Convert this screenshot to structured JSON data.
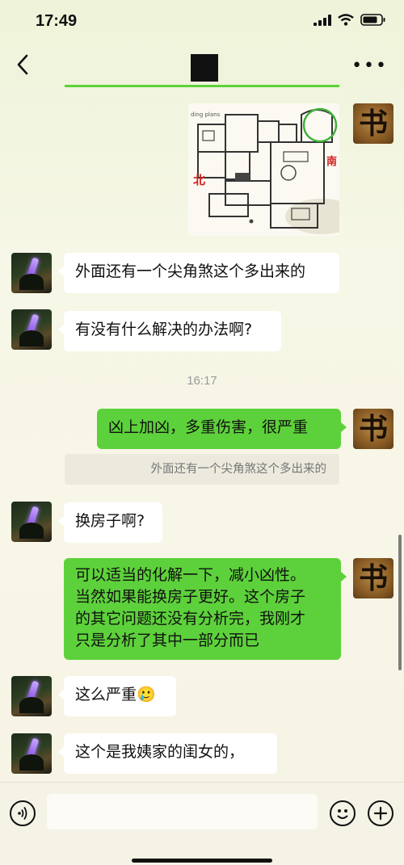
{
  "status_bar": {
    "time": "17:49"
  },
  "header": {
    "title": ""
  },
  "messages": [
    {
      "sender": "me",
      "type": "image",
      "labels": [
        "ding plans",
        "北",
        "南"
      ]
    },
    {
      "sender": "other",
      "text": "外面还有一个尖角煞这个多出来的"
    },
    {
      "sender": "other",
      "text": "有没有什么解决的办法啊?"
    },
    {
      "sender": "system",
      "text": "16:17"
    },
    {
      "sender": "me",
      "text": "凶上加凶，多重伤害，很严重",
      "quote": "外面还有一个尖角煞这个多出来的"
    },
    {
      "sender": "other",
      "text": "换房子啊?"
    },
    {
      "sender": "me",
      "lines": [
        "可以适当的化解一下，减小凶性。",
        "当然如果能换房子更好。这个房子",
        "的其它问题还没有分析完，我刚才",
        "只是分析了其中一部分而已"
      ]
    },
    {
      "sender": "other",
      "text": "这么严重",
      "emoji": "🥲"
    },
    {
      "sender": "other",
      "text": "这个是我姨家的闺女的，"
    }
  ],
  "avatars": {
    "me": "书"
  },
  "colors": {
    "bubble_me": "#5dd13b",
    "bubble_other": "#ffffff",
    "accent": "#5ed13a"
  },
  "icons": [
    "back-icon",
    "more-icon",
    "signal-icon",
    "wifi-icon",
    "battery-icon",
    "voice-icon",
    "emoji-icon",
    "plus-icon"
  ]
}
